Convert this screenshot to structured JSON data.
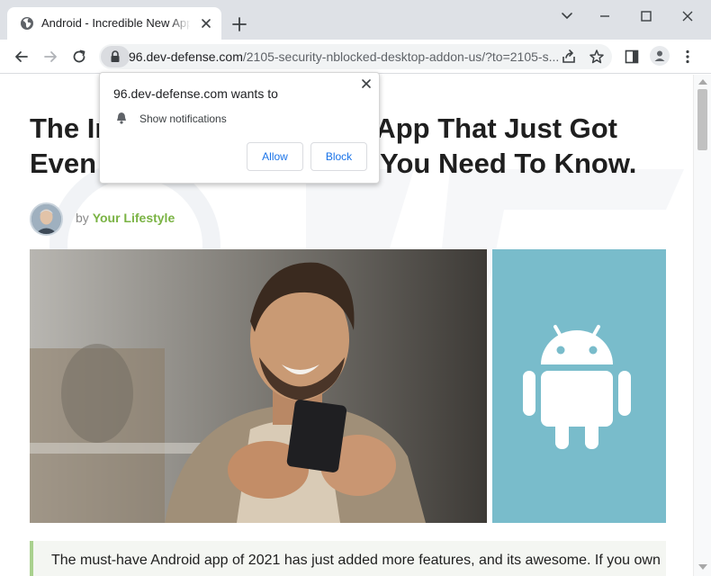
{
  "browser": {
    "tab_title": "Android - Incredible New App - I",
    "url_host": "96.dev-defense.com",
    "url_path": "/2105-security-nblocked-desktop-addon-us/?to=2105-s..."
  },
  "permission_prompt": {
    "title": "96.dev-defense.com wants to",
    "permission": "Show notifications",
    "allow_label": "Allow",
    "block_label": "Block"
  },
  "article": {
    "headline_line1_left": "The In",
    "headline_line1_right": "l App That Just Got",
    "headline_line2_left": "Even",
    "headline_line2_right": "You Need To Know.",
    "byline_prefix": "by",
    "author": "Your Lifestyle",
    "intro": "The must-have Android app of 2021 has just added more features, and its awesome. If you own"
  },
  "colors": {
    "accent_green": "#7ab344",
    "android_tile": "#79bccb",
    "link_blue": "#1a73e8"
  }
}
